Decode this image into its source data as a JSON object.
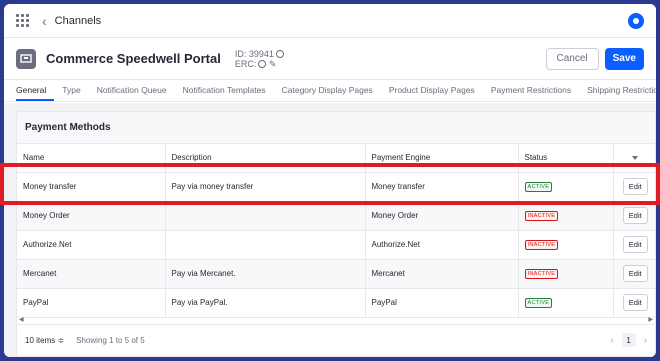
{
  "topbar": {
    "breadcrumb": "Channels",
    "back_icon": "chevron-left-icon",
    "apps_icon": "apps-grid-icon",
    "user_icon": "user-avatar-icon"
  },
  "header": {
    "store_icon": "storefront-icon",
    "title": "Commerce Speedwell Portal",
    "id_label": "ID: 39941",
    "erc_label": "ERC:",
    "cancel_label": "Cancel",
    "save_label": "Save"
  },
  "tabs": [
    {
      "label": "General",
      "active": true
    },
    {
      "label": "Type"
    },
    {
      "label": "Notification Queue"
    },
    {
      "label": "Notification Templates"
    },
    {
      "label": "Category Display Pages"
    },
    {
      "label": "Product Display Pages"
    },
    {
      "label": "Payment Restrictions"
    },
    {
      "label": "Shipping Restrictions"
    }
  ],
  "payment_methods": {
    "title": "Payment Methods",
    "columns": [
      "Name",
      "Description",
      "Payment Engine",
      "Status"
    ],
    "edit_label": "Edit",
    "rows": [
      {
        "name": "Money transfer",
        "description": "Pay via money transfer",
        "engine": "Money transfer",
        "status": "ACTIVE"
      },
      {
        "name": "Money Order",
        "description": "",
        "engine": "Money Order",
        "status": "INACTIVE"
      },
      {
        "name": "Authorize.Net",
        "description": "",
        "engine": "Authorize.Net",
        "status": "INACTIVE"
      },
      {
        "name": "Mercanet",
        "description": "Pay via Mercanet.",
        "engine": "Mercanet",
        "status": "INACTIVE"
      },
      {
        "name": "PayPal",
        "description": "Pay via PayPal.",
        "engine": "PayPal",
        "status": "ACTIVE"
      }
    ]
  },
  "footer": {
    "items_per_page": "10 items ≑",
    "showing": "Showing 1 to 5 of 5",
    "current_page": "1"
  },
  "colors": {
    "primary": "#0b5fff",
    "highlight": "#e01b24",
    "active": "#287d3c",
    "inactive": "#da1414"
  }
}
